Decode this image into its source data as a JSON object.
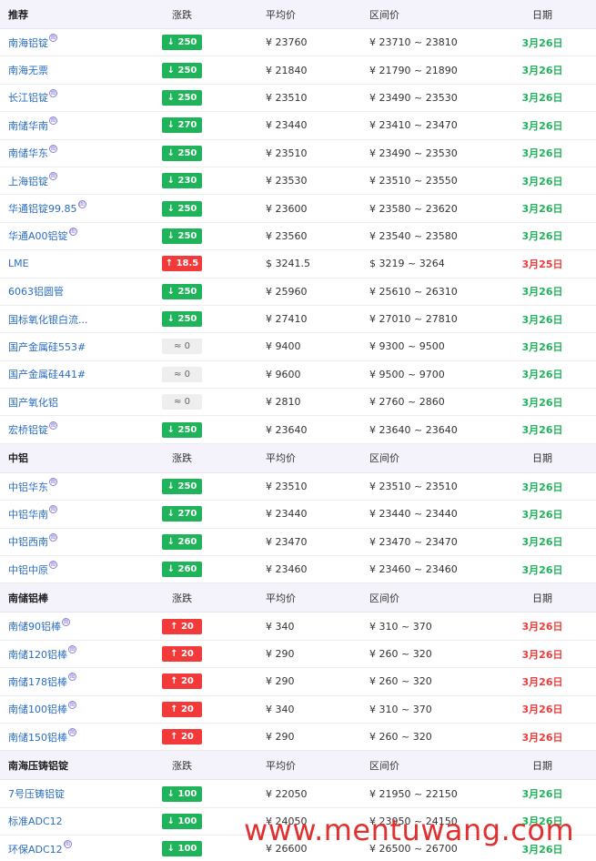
{
  "columns": {
    "change": "涨跌",
    "avg": "平均价",
    "range": "区间价",
    "date": "日期"
  },
  "sections": [
    {
      "title": "推荐",
      "rows": [
        {
          "name": "南海铝锭",
          "sup": true,
          "dir": "down",
          "change": "↓ 250",
          "avg": "¥ 23760",
          "range": "¥ 23710 ~ 23810",
          "date": "3月26日",
          "date_color": "green"
        },
        {
          "name": "南海无票",
          "sup": false,
          "dir": "down",
          "change": "↓ 250",
          "avg": "¥ 21840",
          "range": "¥ 21790 ~ 21890",
          "date": "3月26日",
          "date_color": "green"
        },
        {
          "name": "长江铝锭",
          "sup": true,
          "dir": "down",
          "change": "↓ 250",
          "avg": "¥ 23510",
          "range": "¥ 23490 ~ 23530",
          "date": "3月26日",
          "date_color": "green"
        },
        {
          "name": "南储华南",
          "sup": true,
          "dir": "down",
          "change": "↓ 270",
          "avg": "¥ 23440",
          "range": "¥ 23410 ~ 23470",
          "date": "3月26日",
          "date_color": "green"
        },
        {
          "name": "南储华东",
          "sup": true,
          "dir": "down",
          "change": "↓ 250",
          "avg": "¥ 23510",
          "range": "¥ 23490 ~ 23530",
          "date": "3月26日",
          "date_color": "green"
        },
        {
          "name": "上海铝锭",
          "sup": true,
          "dir": "down",
          "change": "↓ 230",
          "avg": "¥ 23530",
          "range": "¥ 23510 ~ 23550",
          "date": "3月26日",
          "date_color": "green"
        },
        {
          "name": "华通铝锭99.85",
          "sup": true,
          "dir": "down",
          "change": "↓ 250",
          "avg": "¥ 23600",
          "range": "¥ 23580 ~ 23620",
          "date": "3月26日",
          "date_color": "green"
        },
        {
          "name": "华通A00铝锭",
          "sup": true,
          "dir": "down",
          "change": "↓ 250",
          "avg": "¥ 23560",
          "range": "¥ 23540 ~ 23580",
          "date": "3月26日",
          "date_color": "green"
        },
        {
          "name": "LME",
          "sup": false,
          "dir": "up",
          "change": "↑ 18.5",
          "avg": "$ 3241.5",
          "range": "$ 3219 ~ 3264",
          "date": "3月25日",
          "date_color": "red"
        },
        {
          "name": "6063铝圆管",
          "sup": false,
          "dir": "down",
          "change": "↓ 250",
          "avg": "¥ 25960",
          "range": "¥ 25610 ~ 26310",
          "date": "3月26日",
          "date_color": "green"
        },
        {
          "name": "国标氧化银白流...",
          "sup": false,
          "dir": "down",
          "change": "↓ 250",
          "avg": "¥ 27410",
          "range": "¥ 27010 ~ 27810",
          "date": "3月26日",
          "date_color": "green"
        },
        {
          "name": "国产金属硅553#",
          "sup": false,
          "dir": "flat",
          "change": "≈ 0",
          "avg": "¥ 9400",
          "range": "¥ 9300 ~ 9500",
          "date": "3月26日",
          "date_color": "green"
        },
        {
          "name": "国产金属硅441#",
          "sup": false,
          "dir": "flat",
          "change": "≈ 0",
          "avg": "¥ 9600",
          "range": "¥ 9500 ~ 9700",
          "date": "3月26日",
          "date_color": "green"
        },
        {
          "name": "国产氧化铝",
          "sup": false,
          "dir": "flat",
          "change": "≈ 0",
          "avg": "¥ 2810",
          "range": "¥ 2760 ~ 2860",
          "date": "3月26日",
          "date_color": "green"
        },
        {
          "name": "宏桥铝锭",
          "sup": true,
          "dir": "down",
          "change": "↓ 250",
          "avg": "¥ 23640",
          "range": "¥ 23640 ~ 23640",
          "date": "3月26日",
          "date_color": "green"
        }
      ]
    },
    {
      "title": "中铝",
      "rows": [
        {
          "name": "中铝华东",
          "sup": true,
          "dir": "down",
          "change": "↓ 250",
          "avg": "¥ 23510",
          "range": "¥ 23510 ~ 23510",
          "date": "3月26日",
          "date_color": "green"
        },
        {
          "name": "中铝华南",
          "sup": true,
          "dir": "down",
          "change": "↓ 270",
          "avg": "¥ 23440",
          "range": "¥ 23440 ~ 23440",
          "date": "3月26日",
          "date_color": "green"
        },
        {
          "name": "中铝西南",
          "sup": true,
          "dir": "down",
          "change": "↓ 260",
          "avg": "¥ 23470",
          "range": "¥ 23470 ~ 23470",
          "date": "3月26日",
          "date_color": "green"
        },
        {
          "name": "中铝中原",
          "sup": true,
          "dir": "down",
          "change": "↓ 260",
          "avg": "¥ 23460",
          "range": "¥ 23460 ~ 23460",
          "date": "3月26日",
          "date_color": "green"
        }
      ]
    },
    {
      "title": "南储铝棒",
      "rows": [
        {
          "name": "南储90铝棒",
          "sup": true,
          "dir": "up",
          "change": "↑ 20",
          "avg": "¥ 340",
          "range": "¥ 310 ~ 370",
          "date": "3月26日",
          "date_color": "red"
        },
        {
          "name": "南储120铝棒",
          "sup": true,
          "dir": "up",
          "change": "↑ 20",
          "avg": "¥ 290",
          "range": "¥ 260 ~ 320",
          "date": "3月26日",
          "date_color": "red"
        },
        {
          "name": "南储178铝棒",
          "sup": true,
          "dir": "up",
          "change": "↑ 20",
          "avg": "¥ 290",
          "range": "¥ 260 ~ 320",
          "date": "3月26日",
          "date_color": "red"
        },
        {
          "name": "南储100铝棒",
          "sup": true,
          "dir": "up",
          "change": "↑ 20",
          "avg": "¥ 340",
          "range": "¥ 310 ~ 370",
          "date": "3月26日",
          "date_color": "red"
        },
        {
          "name": "南储150铝棒",
          "sup": true,
          "dir": "up",
          "change": "↑ 20",
          "avg": "¥ 290",
          "range": "¥ 260 ~ 320",
          "date": "3月26日",
          "date_color": "red"
        }
      ]
    },
    {
      "title": "南海压铸铝锭",
      "rows": [
        {
          "name": "7号压铸铝锭",
          "sup": false,
          "dir": "down",
          "change": "↓ 100",
          "avg": "¥ 22050",
          "range": "¥ 21950 ~ 22150",
          "date": "3月26日",
          "date_color": "green"
        },
        {
          "name": "标准ADC12",
          "sup": false,
          "dir": "down",
          "change": "↓ 100",
          "avg": "¥ 24050",
          "range": "¥ 23950 ~ 24150",
          "date": "3月26日",
          "date_color": "green"
        },
        {
          "name": "环保ADC12",
          "sup": true,
          "dir": "down",
          "change": "↓ 100",
          "avg": "¥ 26600",
          "range": "¥ 26500 ~ 26700",
          "date": "3月26日",
          "date_color": "green"
        }
      ]
    }
  ],
  "sup_glyph": "图",
  "watermark": "www.mentuwang.com",
  "colors": {
    "down": "#1fb35a",
    "up": "#f23a3a",
    "link": "#2b6dc4",
    "header_bg": "#f4f3fb"
  }
}
